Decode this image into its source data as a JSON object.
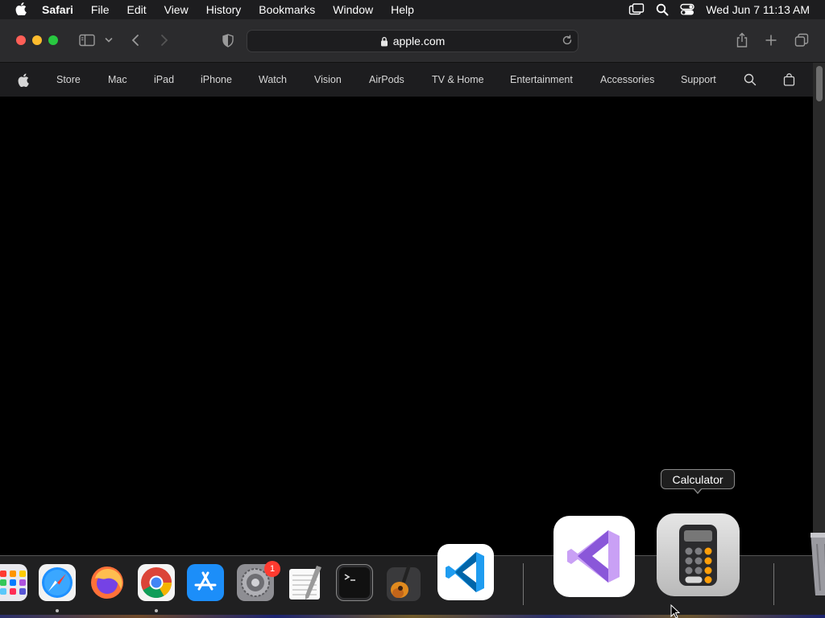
{
  "menubar": {
    "app_name": "Safari",
    "items": [
      "File",
      "Edit",
      "View",
      "History",
      "Bookmarks",
      "Window",
      "Help"
    ],
    "clock": "Wed Jun 7  11:13 AM"
  },
  "toolbar": {
    "url": "apple.com"
  },
  "global_nav": {
    "items": [
      "Store",
      "Mac",
      "iPad",
      "iPhone",
      "Watch",
      "Vision",
      "AirPods",
      "TV & Home",
      "Entertainment",
      "Accessories",
      "Support"
    ]
  },
  "dock": {
    "tooltip": "Calculator",
    "settings_badge": "1",
    "apps": [
      "launchpad",
      "safari",
      "firefox",
      "chrome",
      "app-store",
      "system-settings",
      "textedit",
      "terminal",
      "garageband",
      "vscode",
      "visual-studio",
      "calculator",
      "trash"
    ]
  },
  "colors": {
    "menubar_bg": "#1d1d1f",
    "toolbar_bg": "#2b2b2d",
    "close": "#ff5f57",
    "minimize": "#febc2e",
    "maximize": "#28c840",
    "badge": "#ff3b30"
  }
}
